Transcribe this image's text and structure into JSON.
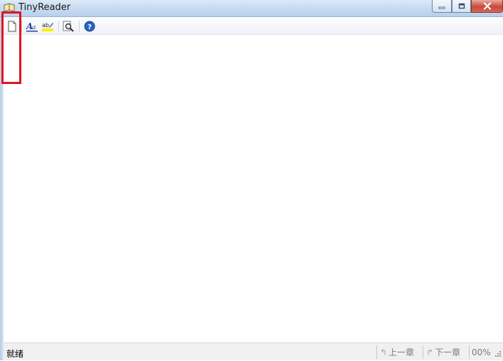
{
  "window": {
    "title": "TinyReader",
    "icon": "book-icon"
  },
  "toolbar": {
    "buttons": [
      {
        "name": "new-document",
        "icon": "document-icon"
      },
      {
        "name": "font",
        "icon": "font-icon"
      },
      {
        "name": "text-color",
        "icon": "highlight-icon"
      },
      {
        "name": "search",
        "icon": "magnifier-icon"
      },
      {
        "name": "help",
        "icon": "help-icon"
      }
    ]
  },
  "statusbar": {
    "status": "就绪",
    "prev_chapter": "上一章",
    "next_chapter": "下一章",
    "progress": "00%"
  },
  "colors": {
    "highlight_box": "#e0161e",
    "close_button": "#c84a3a"
  }
}
